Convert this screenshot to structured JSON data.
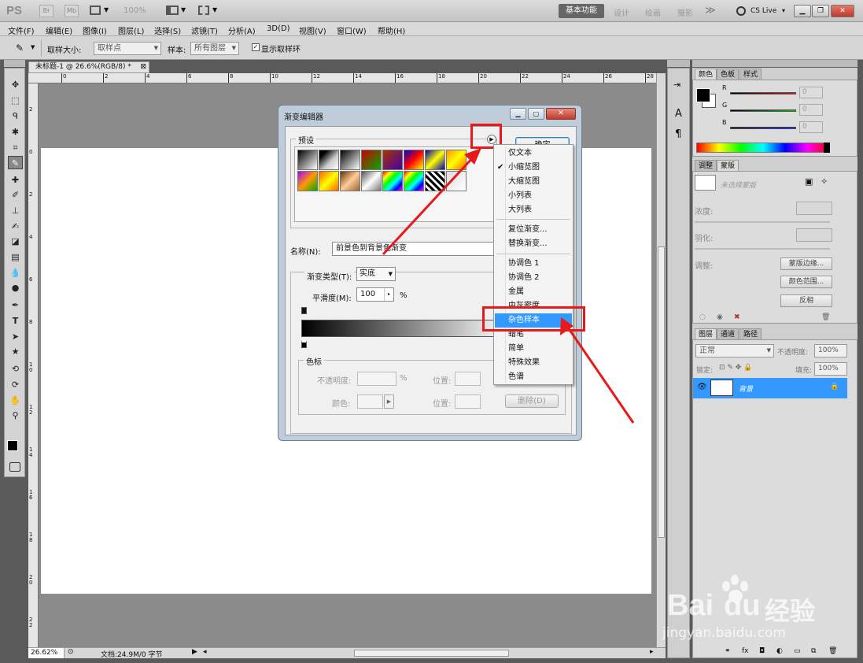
{
  "appbar": {
    "logo": "PS",
    "btn_br": "Br",
    "btn_mb": "Mb",
    "zoom": "100%",
    "workspace_active": "基本功能",
    "workspaces": [
      "设计",
      "绘画",
      "摄影"
    ],
    "more": "≫",
    "cslive": "CS Live",
    "cslive_arrow": "▾"
  },
  "menu": [
    "文件(F)",
    "编辑(E)",
    "图像(I)",
    "图层(L)",
    "选择(S)",
    "滤镜(T)",
    "分析(A)",
    "3D(D)",
    "视图(V)",
    "窗口(W)",
    "帮助(H)"
  ],
  "options": {
    "sample_size_label": "取样大小:",
    "sample_size_value": "取样点",
    "sample_label": "样本:",
    "sample_value": "所有图层",
    "show_ring_label": "显示取样环"
  },
  "document": {
    "tab_title": "未标题-1 @ 26.6%(RGB/8) *",
    "ruler_top": [
      "0",
      "2",
      "4",
      "6",
      "8",
      "10",
      "12",
      "14",
      "16",
      "18",
      "20",
      "22",
      "24",
      "26",
      "28"
    ],
    "ruler_left": [
      "2",
      "0",
      "2",
      "4",
      "6",
      "8",
      "1\n0",
      "1\n2",
      "1\n4",
      "1\n6",
      "1\n8",
      "2\n0",
      "2\n2"
    ],
    "status_zoom": "26.62%",
    "status_doc": "文档:24.9M/0 字节"
  },
  "color_panel": {
    "tabs": [
      "颜色",
      "色板",
      "样式"
    ],
    "labels": [
      "R",
      "G",
      "B"
    ],
    "values": [
      "0",
      "0",
      "0"
    ]
  },
  "adjust_panel": {
    "tabs": [
      "调整",
      "蒙版"
    ],
    "mask_text": "未选择蒙版",
    "density_label": "浓度:",
    "feather_label": "羽化:",
    "refine_label": "调整:",
    "buttons": [
      "蒙版边缘...",
      "颜色范围...",
      "反相"
    ]
  },
  "layers_panel": {
    "tabs": [
      "图层",
      "通道",
      "路径"
    ],
    "blend_mode": "正常",
    "opacity_label": "不透明度:",
    "opacity": "100%",
    "lock_label": "锁定:",
    "fill_label": "填充:",
    "fill": "100%",
    "layer_name": "背景"
  },
  "dialog": {
    "title": "渐变编辑器",
    "preset_label": "预设",
    "ok_label": "确定",
    "name_label": "名称(N):",
    "name_value": "前景色到背景色渐变",
    "type_label": "渐变类型(T):",
    "type_value": "实底",
    "smooth_label": "平滑度(M):",
    "smooth_value": "100",
    "percent": "%",
    "colorstop_label": "色标",
    "opacity_label": "不透明度:",
    "position_label": "位置:",
    "color_label": "颜色:",
    "delete_label": "删除(D)"
  },
  "context_menu": {
    "items": [
      "仅文本",
      "小缩览图",
      "大缩览图",
      "小列表",
      "大列表",
      "复位渐变...",
      "替换渐变...",
      "协调色 1",
      "协调色 2",
      "金属",
      "中灰密度",
      "杂色样本",
      "蜡笔",
      "简单",
      "特殊效果",
      "色谱"
    ],
    "checked_index": 1,
    "highlight_index": 11
  },
  "watermark": {
    "brand": "Bai",
    "brand2": "du",
    "cn": "经验",
    "url": "jingyan.baidu.com"
  },
  "colors": {
    "highlight": "#3399ff",
    "annotation_red": "#e8191a",
    "layer_selected": "#3399ff"
  }
}
